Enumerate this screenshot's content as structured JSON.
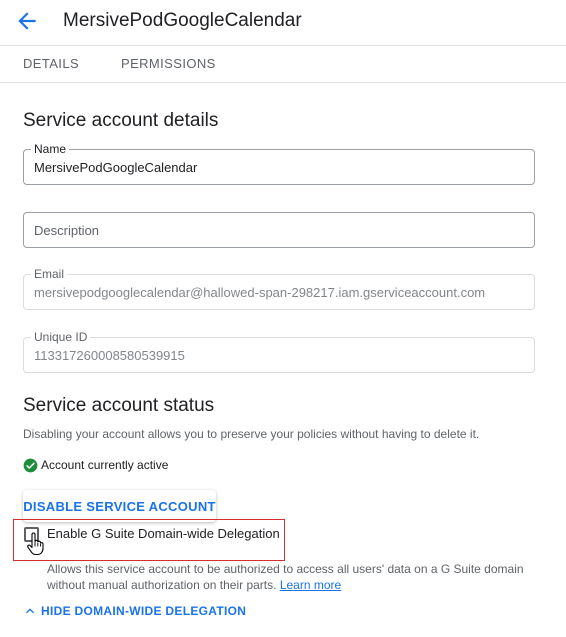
{
  "header": {
    "back_icon": "arrow-left-icon",
    "title": "MersivePodGoogleCalendar"
  },
  "tabs": [
    {
      "label": "DETAILS"
    },
    {
      "label": "PERMISSIONS"
    }
  ],
  "details": {
    "section_title": "Service account details",
    "name": {
      "label": "Name",
      "value": "MersivePodGoogleCalendar"
    },
    "description": {
      "placeholder": "Description",
      "value": ""
    },
    "email": {
      "label": "Email",
      "value": "mersivepodgooglecalendar@hallowed-span-298217.iam.gserviceaccount.com"
    },
    "unique_id": {
      "label": "Unique ID",
      "value": "113317260008580539915"
    }
  },
  "status": {
    "section_title": "Service account status",
    "help_text": "Disabling your account allows you to preserve your policies without having to delete it.",
    "active_icon": "check-circle-icon",
    "active_text": "Account currently active",
    "disable_button": "DISABLE SERVICE ACCOUNT"
  },
  "delegation": {
    "checkbox_label": "Enable G Suite Domain-wide Delegation",
    "checked": false,
    "help_text": "Allows this service account to be authorized to access all users' data on a G Suite domain without manual authorization on their parts.",
    "learn_more": "Learn more",
    "hide_toggle": "HIDE DOMAIN-WIDE DELEGATION"
  },
  "colors": {
    "accent": "#1a73e8",
    "success": "#1e8e3e",
    "highlight": "#d32f2f"
  }
}
